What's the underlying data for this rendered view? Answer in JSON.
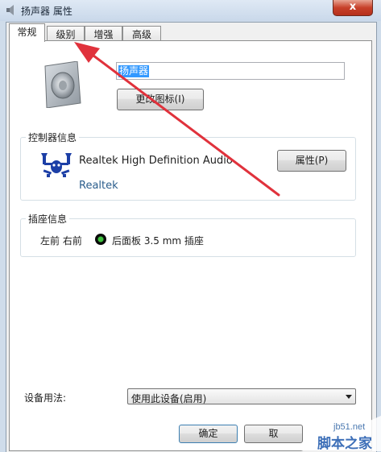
{
  "window": {
    "title": "扬声器 属性",
    "close_label": "x"
  },
  "tabs": [
    {
      "label": "常规",
      "active": true
    },
    {
      "label": "级别",
      "active": false
    },
    {
      "label": "增强",
      "active": false
    },
    {
      "label": "高级",
      "active": false
    }
  ],
  "general": {
    "device_name": "扬声器",
    "change_icon_label": "更改图标(I)"
  },
  "controller": {
    "group_title": "控制器信息",
    "device": "Realtek High Definition Audio",
    "vendor": "Realtek",
    "properties_label": "属性(P)"
  },
  "jack": {
    "group_title": "插座信息",
    "channels": "左前 右前",
    "location": "后面板 3.5 mm 插座",
    "jack_color": "#3fc23f"
  },
  "usage": {
    "label": "设备用法:",
    "selected": "使用此设备(启用)"
  },
  "buttons": {
    "ok_label": "确定",
    "cancel_label": "取"
  },
  "watermark": {
    "site": "jb51.net",
    "brand": "脚本之家"
  },
  "annotation": {
    "arrow_color": "#e0323c"
  }
}
